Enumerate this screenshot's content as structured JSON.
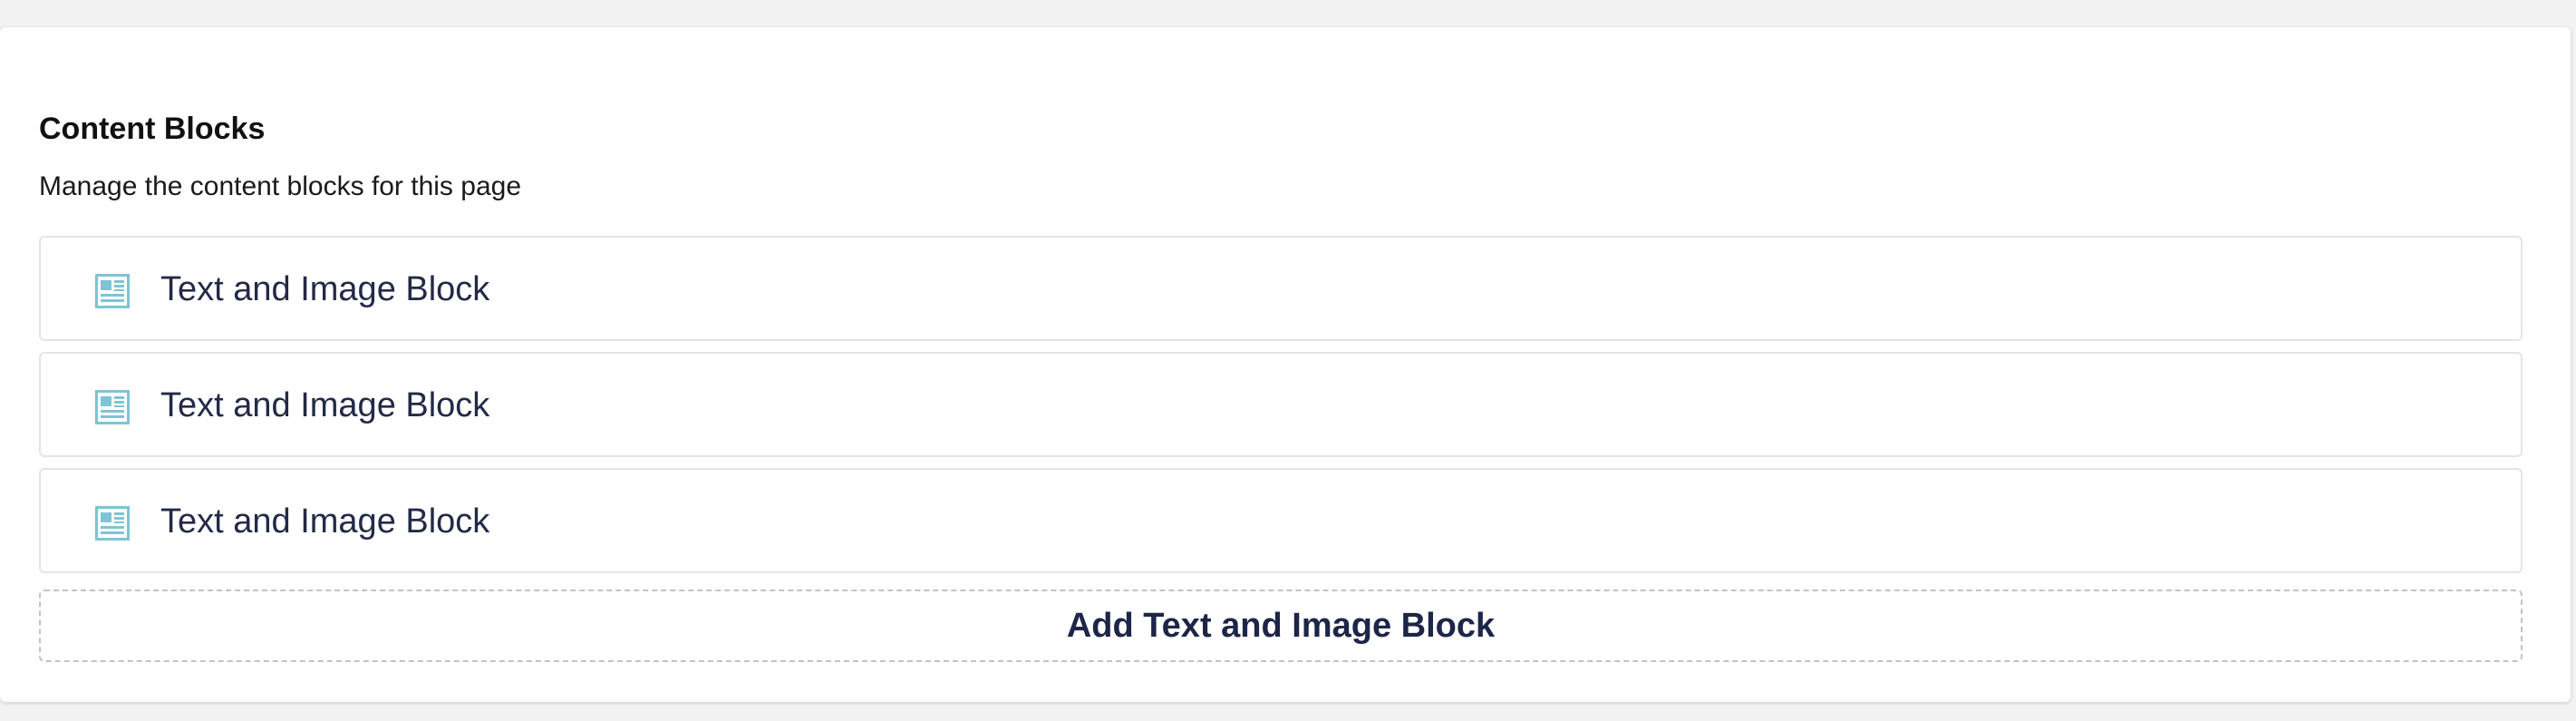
{
  "panel": {
    "title": "Content Blocks",
    "description": "Manage the content blocks for this page"
  },
  "blocks": [
    {
      "label": "Text and Image Block",
      "icon": "text-image-icon"
    },
    {
      "label": "Text and Image Block",
      "icon": "text-image-icon"
    },
    {
      "label": "Text and Image Block",
      "icon": "text-image-icon"
    }
  ],
  "add_button": {
    "label": "Add Text and Image Block"
  },
  "colors": {
    "icon": "#7fc4d4",
    "text": "#222a47",
    "border": "#e2e4e8",
    "dashed_border": "#bfc3ca",
    "page_bg": "#f3f2f2"
  }
}
